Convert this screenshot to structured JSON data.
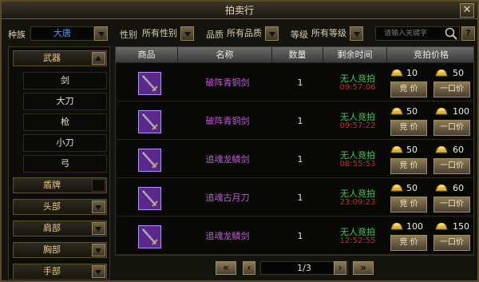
{
  "window": {
    "title": "拍卖行"
  },
  "filters": {
    "race_label": "种族",
    "race_value": "大唐",
    "gender_label": "性别",
    "gender_value": "所有性别",
    "quality_label": "品质",
    "quality_value": "所有品质",
    "level_label": "等级",
    "level_value": "所有等级",
    "search_placeholder": "请输入关键字",
    "help_label": "?"
  },
  "sidebar": {
    "categories": [
      {
        "label": "武器",
        "expanded": true
      },
      {
        "label": "盾牌"
      },
      {
        "label": "头部"
      },
      {
        "label": "肩部"
      },
      {
        "label": "胸部"
      },
      {
        "label": "手部"
      }
    ],
    "weapon_subitems": [
      "剑",
      "大刀",
      "枪",
      "小刀",
      "弓"
    ]
  },
  "table": {
    "headers": [
      "商品",
      "名称",
      "数量",
      "剩余时间",
      "竞拍价格"
    ],
    "rows": [
      {
        "name": "破阵青铜剑",
        "qty": "1",
        "status": "无人竞拍",
        "time": "09:57:06",
        "bid": "10",
        "buyout": "50"
      },
      {
        "name": "破阵青铜剑",
        "qty": "1",
        "status": "无人竞拍",
        "time": "09:57:22",
        "bid": "50",
        "buyout": "100"
      },
      {
        "name": "追魂龙鳞剑",
        "qty": "1",
        "status": "无人竞拍",
        "time": "08:55:53",
        "bid": "50",
        "buyout": "60"
      },
      {
        "name": "追魂古月刀",
        "qty": "1",
        "status": "无人竞拍",
        "time": "23:09:23",
        "bid": "50",
        "buyout": "60"
      },
      {
        "name": "追魂龙鳞剑",
        "qty": "1",
        "status": "无人竞拍",
        "time": "12:52:55",
        "bid": "100",
        "buyout": "150"
      }
    ],
    "bid_button_label": "竞 价",
    "buyout_button_label": "一口价"
  },
  "pager": {
    "first": "«",
    "prev": "‹",
    "page": "1/3",
    "next": "›",
    "last": "»"
  },
  "colors": {
    "item_name": "#c35ad8",
    "status": "#3fcf3f",
    "timer": "#e02020",
    "accent_gold": "#e6c98a"
  },
  "icons": [
    "close-icon",
    "search-icon",
    "help-icon",
    "gold-ingot-icon",
    "sword-icon",
    "chevron-down-icon",
    "chevron-up-icon"
  ]
}
